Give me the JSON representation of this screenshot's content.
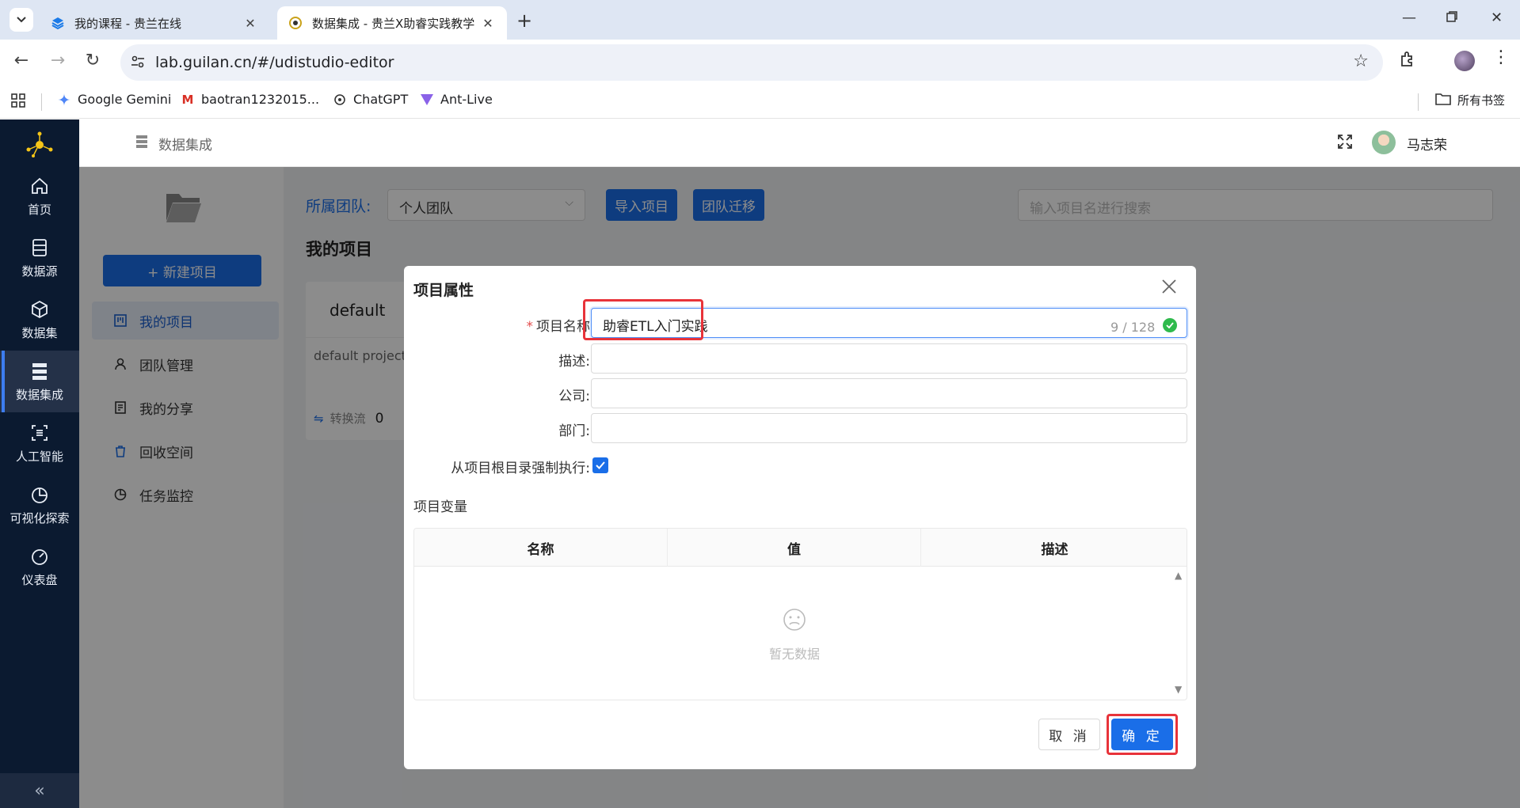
{
  "browser": {
    "tabs": [
      {
        "title": "我的课程 - 贵兰在线",
        "active": false
      },
      {
        "title": "数据集成 - 贵兰X助睿实践教学",
        "active": true
      }
    ],
    "url": "lab.guilan.cn/#/udistudio-editor",
    "bookmarks": [
      {
        "label": "Google Gemini",
        "icon": "gemini-icon"
      },
      {
        "label": "baotran1232015...",
        "icon": "gmail-icon"
      },
      {
        "label": "ChatGPT",
        "icon": "chatgpt-icon"
      },
      {
        "label": "Ant-Live",
        "icon": "ant-live-icon"
      }
    ],
    "all_bookmarks": "所有书签"
  },
  "sidebar": {
    "items": [
      {
        "label": "首页",
        "icon": "home-icon"
      },
      {
        "label": "数据源",
        "icon": "datasource-icon"
      },
      {
        "label": "数据集",
        "icon": "dataset-icon"
      },
      {
        "label": "数据集成",
        "icon": "integration-icon",
        "active": true
      },
      {
        "label": "人工智能",
        "icon": "ai-icon"
      },
      {
        "label": "可视化探索",
        "icon": "chart-icon"
      },
      {
        "label": "仪表盘",
        "icon": "dashboard-icon"
      }
    ],
    "collapse": "«"
  },
  "header": {
    "breadcrumb": "数据集成",
    "username": "马志荣"
  },
  "left_panel": {
    "new_project": "+ 新建项目",
    "items": [
      {
        "label": "我的项目",
        "active": true
      },
      {
        "label": "团队管理"
      },
      {
        "label": "我的分享"
      },
      {
        "label": "回收空间"
      },
      {
        "label": "任务监控"
      }
    ]
  },
  "main": {
    "team_label": "所属团队:",
    "team_value": "个人团队",
    "import_button": "导入项目",
    "migrate_button": "团队迁移",
    "search_placeholder": "输入项目名进行搜索",
    "section_title": "我的项目",
    "card": {
      "title": "default",
      "description": "default project",
      "stat_label": "转换流",
      "stat_value": "0"
    }
  },
  "modal": {
    "title": "项目属性",
    "fields": {
      "name_label": "项目名称",
      "name_value": "助睿ETL入门实践",
      "name_count": "9 / 128",
      "description_label": "描述:",
      "company_label": "公司:",
      "department_label": "部门:",
      "force_label": "从项目根目录强制执行:"
    },
    "vars_title": "项目变量",
    "table": {
      "columns": [
        "名称",
        "值",
        "描述"
      ],
      "empty_text": "暂无数据"
    },
    "cancel": "取 消",
    "ok": "确 定"
  }
}
